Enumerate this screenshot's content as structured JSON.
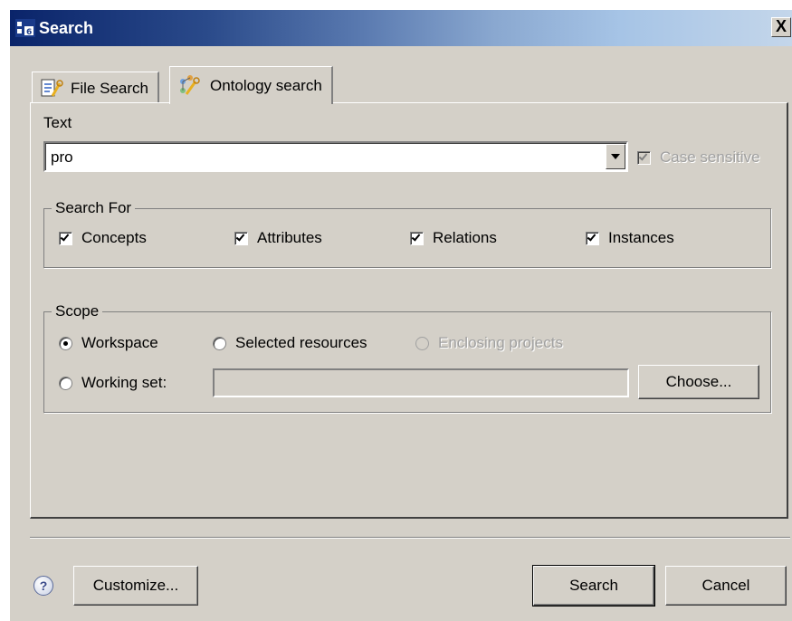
{
  "window": {
    "title": "Search",
    "close_glyph": "X"
  },
  "tabs": [
    {
      "label": "File Search",
      "icon": "file-search-icon",
      "active": false
    },
    {
      "label": "Ontology search",
      "icon": "ontology-search-icon",
      "active": true
    }
  ],
  "text_section": {
    "label": "Text",
    "value": "pro",
    "case_sensitive": {
      "label": "Case sensitive",
      "checked": true,
      "enabled": false
    }
  },
  "search_for": {
    "title": "Search For",
    "options": [
      {
        "label": "Concepts",
        "checked": true
      },
      {
        "label": "Attributes",
        "checked": true
      },
      {
        "label": "Relations",
        "checked": true
      },
      {
        "label": "Instances",
        "checked": true
      }
    ]
  },
  "scope": {
    "title": "Scope",
    "workspace": {
      "label": "Workspace",
      "selected": true
    },
    "selected_resources": {
      "label": "Selected resources",
      "selected": false
    },
    "enclosing_projects": {
      "label": "Enclosing projects",
      "selected": false,
      "enabled": false
    },
    "working_set": {
      "label": "Working set:",
      "selected": false,
      "value": ""
    },
    "choose_label": "Choose..."
  },
  "footer": {
    "help_glyph": "?",
    "customize_label": "Customize...",
    "search_label": "Search",
    "cancel_label": "Cancel"
  }
}
